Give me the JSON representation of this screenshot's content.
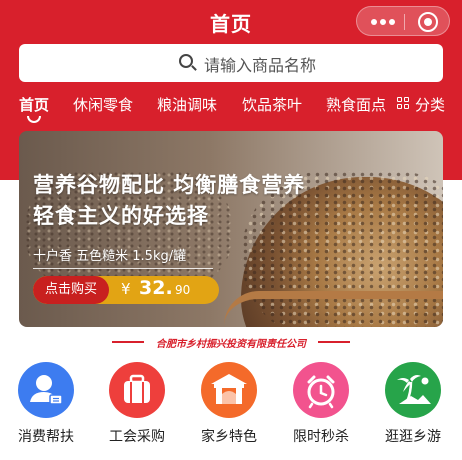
{
  "header": {
    "title": "首页",
    "search_placeholder": "请输入商品名称"
  },
  "tabs": [
    {
      "label": "首页",
      "active": true
    },
    {
      "label": "休闲零食"
    },
    {
      "label": "粮油调味"
    },
    {
      "label": "饮品茶叶"
    },
    {
      "label": "熟食面点"
    },
    {
      "label": "分类",
      "icon": "grid-icon"
    }
  ],
  "banner": {
    "headline_1": "营养谷物配比 均衡膳食营养",
    "headline_2": "轻食主义的好选择",
    "product": "十户香 五色糙米 1.5kg/罐",
    "buy_label": "点击购买",
    "price_symbol": "¥",
    "price_int": "32.",
    "price_dec": "90"
  },
  "company": "合肥市乡村振兴投资有限责任公司",
  "shortcuts": [
    {
      "label": "消费帮扶",
      "icon": "user-card-icon",
      "color": "#3d7cf0"
    },
    {
      "label": "工会采购",
      "icon": "suitcase-icon",
      "color": "#ee3f3c"
    },
    {
      "label": "家乡特色",
      "icon": "archway-icon",
      "color": "#f46a2a"
    },
    {
      "label": "限时秒杀",
      "icon": "alarm-clock-icon",
      "color": "#f2538e"
    },
    {
      "label": "逛逛乡游",
      "icon": "palm-tree-icon",
      "color": "#27a44a"
    }
  ],
  "colors": {
    "brand": "#d8202c",
    "price_bar": "#e2a414"
  }
}
